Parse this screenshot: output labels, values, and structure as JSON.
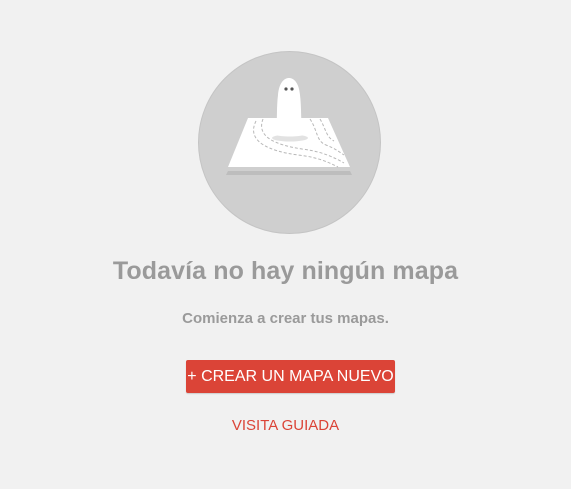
{
  "empty_state": {
    "illustration_icon": "ghost-on-map-icon",
    "headline": "Todavía no hay ningún mapa",
    "subtext": "Comienza a crear tus mapas.",
    "create_button_label": "+ CREAR UN MAPA NUEVO",
    "tour_link_label": "VISITA GUIADA"
  },
  "colors": {
    "background": "#f1f1f1",
    "circle": "#cfcfcf",
    "text_muted": "#9a9a9a",
    "accent": "#db4437"
  }
}
